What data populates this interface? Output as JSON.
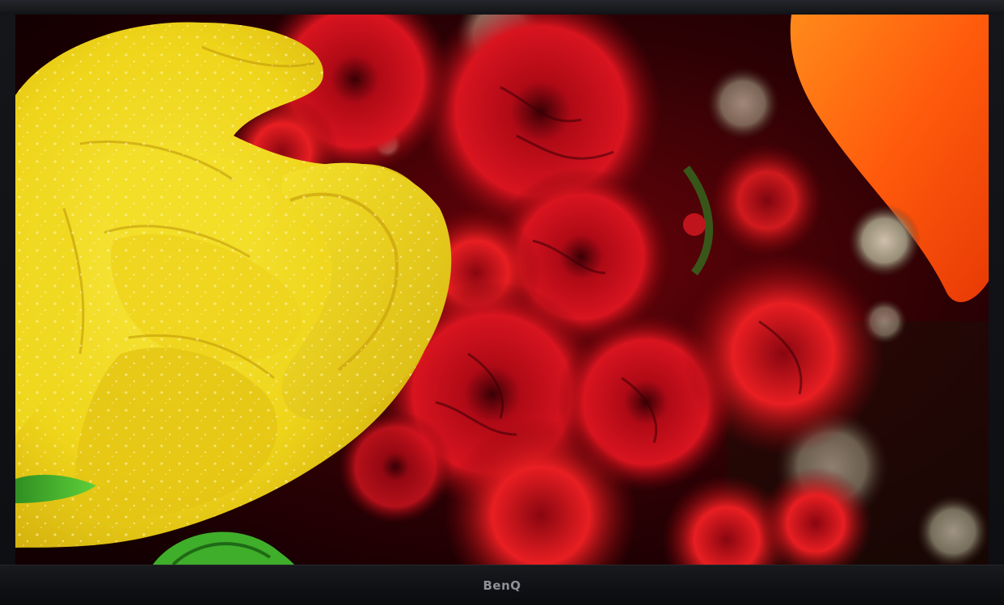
{
  "monitor": {
    "brand": "BenQ"
  },
  "photo": {
    "subject": "flowers",
    "colors": {
      "yellow_petal": "#f2dd1c",
      "yellow_shadow": "#c9a50c",
      "red_flower": "#c0101c",
      "dark_red": "#5a0208",
      "orange_petal": "#ff6a10",
      "stem_green": "#3fae2a",
      "bezel": "#101114"
    }
  }
}
